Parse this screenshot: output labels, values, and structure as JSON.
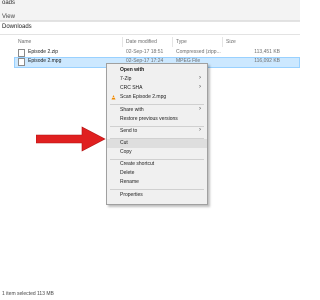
{
  "window": {
    "title": "oads",
    "ribbon_tab": "View",
    "address": "Downloads"
  },
  "columns": {
    "name": "Name",
    "date_modified": "Date modified",
    "type": "Type",
    "size": "Size"
  },
  "files": [
    {
      "name": "Episode 2.zip",
      "date": "02-Sep-17 18:51",
      "type": "Compressed (zipp...",
      "size": "113,451 KB"
    },
    {
      "name": "Episode 2.mpg",
      "date": "02-Sep-17 17:24",
      "type": "MPEG File",
      "size": "116,092 KB"
    }
  ],
  "context_menu": {
    "open_with": "Open with",
    "seven_zip": "7-Zip",
    "crc_sha": "CRC SHA",
    "scan": "Scan Episode 2.mpg",
    "share_with": "Share with",
    "restore": "Restore previous versions",
    "send_to": "Send to",
    "cut": "Cut",
    "copy": "Copy",
    "create_shortcut": "Create shortcut",
    "delete": "Delete",
    "rename": "Rename",
    "properties": "Properties"
  },
  "status": {
    "selection": "1 item selected  113 MB"
  },
  "colors": {
    "selection_bg": "#cce8ff",
    "arrow": "#e02020"
  }
}
